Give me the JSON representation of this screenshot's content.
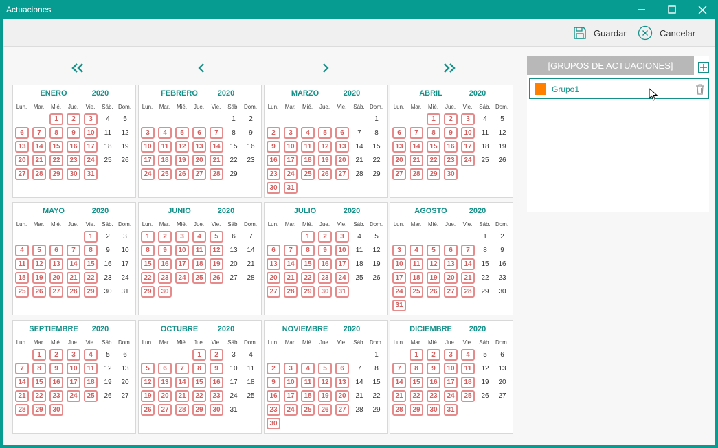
{
  "window": {
    "title": "Actuaciones"
  },
  "toolbar": {
    "save_label": "Guardar",
    "cancel_label": "Cancelar"
  },
  "nav": {
    "first": "«",
    "prev": "‹",
    "next": "›",
    "last": "»"
  },
  "weekdays": [
    "Lun.",
    "Mar.",
    "Mié.",
    "Jue.",
    "Vie.",
    "Sáb.",
    "Dom."
  ],
  "year": "2020",
  "months": [
    {
      "name": "ENERO",
      "offset": 2,
      "days": 31,
      "selected": [
        1,
        2,
        3,
        6,
        7,
        8,
        9,
        10,
        13,
        14,
        15,
        16,
        17,
        20,
        21,
        22,
        23,
        24,
        27,
        28,
        29,
        30,
        31
      ]
    },
    {
      "name": "FEBRERO",
      "offset": 5,
      "days": 29,
      "selected": [
        3,
        4,
        5,
        6,
        7,
        10,
        11,
        12,
        13,
        14,
        17,
        18,
        19,
        20,
        21,
        24,
        25,
        26,
        27,
        28
      ]
    },
    {
      "name": "MARZO",
      "offset": 6,
      "days": 31,
      "selected": [
        2,
        3,
        4,
        5,
        6,
        9,
        10,
        11,
        12,
        13,
        16,
        17,
        18,
        19,
        20,
        23,
        24,
        25,
        26,
        27,
        30,
        31
      ]
    },
    {
      "name": "ABRIL",
      "offset": 2,
      "days": 30,
      "selected": [
        1,
        2,
        3,
        6,
        7,
        8,
        9,
        10,
        13,
        14,
        15,
        16,
        17,
        20,
        21,
        22,
        23,
        24,
        27,
        28,
        29,
        30
      ]
    },
    {
      "name": "MAYO",
      "offset": 4,
      "days": 31,
      "selected": [
        1,
        4,
        5,
        6,
        7,
        8,
        11,
        12,
        13,
        14,
        15,
        18,
        19,
        20,
        21,
        22,
        25,
        26,
        27,
        28,
        29
      ]
    },
    {
      "name": "JUNIO",
      "offset": 0,
      "days": 30,
      "selected": [
        1,
        2,
        3,
        4,
        5,
        8,
        9,
        10,
        11,
        12,
        15,
        16,
        17,
        18,
        19,
        22,
        23,
        24,
        25,
        26,
        29,
        30
      ]
    },
    {
      "name": "JULIO",
      "offset": 2,
      "days": 31,
      "selected": [
        1,
        2,
        3,
        6,
        7,
        8,
        9,
        10,
        13,
        14,
        15,
        16,
        17,
        20,
        21,
        22,
        23,
        24,
        27,
        28,
        29,
        30,
        31
      ]
    },
    {
      "name": "AGOSTO",
      "offset": 5,
      "days": 31,
      "selected": [
        3,
        4,
        5,
        6,
        7,
        10,
        11,
        12,
        13,
        14,
        17,
        18,
        19,
        20,
        21,
        24,
        25,
        26,
        27,
        28,
        31
      ]
    },
    {
      "name": "SEPTIEMBRE",
      "offset": 1,
      "days": 30,
      "selected": [
        1,
        2,
        3,
        4,
        7,
        8,
        9,
        10,
        11,
        14,
        15,
        16,
        17,
        18,
        21,
        22,
        23,
        24,
        25,
        28,
        29,
        30
      ]
    },
    {
      "name": "OCTUBRE",
      "offset": 3,
      "days": 31,
      "selected": [
        1,
        2,
        5,
        6,
        7,
        8,
        9,
        12,
        13,
        14,
        15,
        16,
        19,
        20,
        21,
        22,
        23,
        26,
        27,
        28,
        29,
        30
      ]
    },
    {
      "name": "NOVIEMBRE",
      "offset": 6,
      "days": 30,
      "selected": [
        2,
        3,
        4,
        5,
        6,
        9,
        10,
        11,
        12,
        13,
        16,
        17,
        18,
        19,
        20,
        23,
        24,
        25,
        26,
        27,
        30
      ]
    },
    {
      "name": "DICIEMBRE",
      "offset": 1,
      "days": 31,
      "selected": [
        1,
        2,
        3,
        4,
        7,
        8,
        9,
        10,
        11,
        14,
        15,
        16,
        17,
        18,
        21,
        22,
        23,
        24,
        25,
        28,
        29,
        30,
        31
      ]
    }
  ],
  "groups": {
    "header": "[GRUPOS DE ACTUACIONES]",
    "items": [
      {
        "label": "Grupo1",
        "color": "#ff7f00"
      }
    ]
  },
  "colors": {
    "accent": "#079c91",
    "selected_border": "#e58b8b",
    "selected_text": "#d25e5e"
  }
}
